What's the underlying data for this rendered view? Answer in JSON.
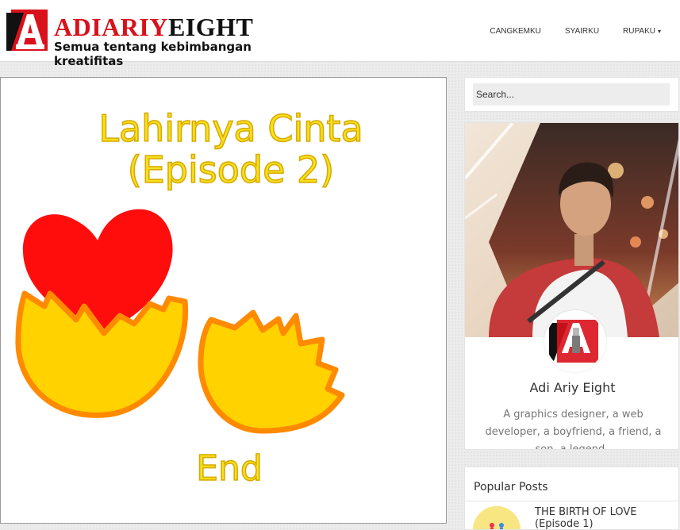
{
  "site": {
    "logo_part1": "ADIARIY",
    "logo_part2": "EIGHT",
    "tagline": "Semua tentang kebimbangan kreatifitas"
  },
  "nav": {
    "items": [
      {
        "label": "CANGKEMKU"
      },
      {
        "label": "SYAIRKU"
      },
      {
        "label": "RUPAKU",
        "caret": "▾"
      }
    ]
  },
  "post": {
    "image_title_line1": "Lahirnya Cinta",
    "image_title_line2": "(Episode 2)",
    "image_end": "End"
  },
  "sidebar": {
    "search": {
      "placeholder": "Search..."
    },
    "profile": {
      "name": "Adi Ariy Eight",
      "bio": "A graphics designer, a web developer, a boyfriend, a friend, a son, a legend.."
    },
    "popular": {
      "title": "Popular Posts",
      "post_title": "THE BIRTH OF LOVE (Episode 1)"
    }
  },
  "colors": {
    "brand_red": "#d9111b",
    "heart_red": "#ff0d0d",
    "egg_yellow": "#ffd200",
    "egg_orange": "#ff8a00",
    "text_yellow": "#f5e11c"
  }
}
